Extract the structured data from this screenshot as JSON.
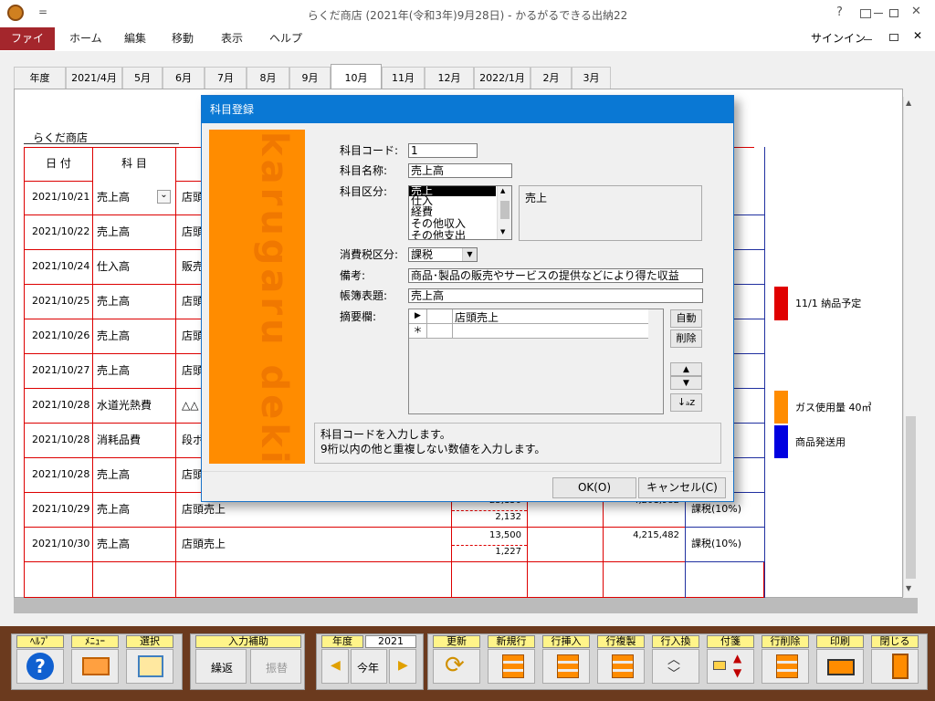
{
  "window": {
    "title": "らくだ商店 (2021年(令和3年)9月28日) - かるがるできる出納22",
    "help_glyph": "?",
    "quick_access_glyph": "="
  },
  "ribbon": {
    "tabs": [
      "ファイル",
      "ホーム",
      "編集",
      "移動",
      "表示",
      "ヘルプ"
    ],
    "signin": "サインイン"
  },
  "month_tabs": [
    "年度",
    "2021/4月",
    "5月",
    "6月",
    "7月",
    "8月",
    "9月",
    "10月",
    "11月",
    "12月",
    "2022/1月",
    "2月",
    "3月"
  ],
  "selected_month": "10月",
  "ledger": {
    "company": "らくだ商店",
    "headers": {
      "date": "日 付",
      "subject": "科 目"
    },
    "rows": [
      {
        "date": "2021/10/21",
        "subject": "売上高",
        "desc": "店頭"
      },
      {
        "date": "2021/10/22",
        "subject": "売上高",
        "desc": "店頭"
      },
      {
        "date": "2021/10/24",
        "subject": "仕入高",
        "desc": "販売"
      },
      {
        "date": "2021/10/25",
        "subject": "売上高",
        "desc": "店頭"
      },
      {
        "date": "2021/10/26",
        "subject": "売上高",
        "desc": "店頭"
      },
      {
        "date": "2021/10/27",
        "subject": "売上高",
        "desc": "店頭"
      },
      {
        "date": "2021/10/28",
        "subject": "水道光熱費",
        "desc": "△△"
      },
      {
        "date": "2021/10/28",
        "subject": "消耗品費",
        "desc": "段ボ"
      },
      {
        "date": "2021/10/28",
        "subject": "売上高",
        "desc": "店頭"
      },
      {
        "date": "2021/10/29",
        "subject": "売上高",
        "desc": "店頭売上",
        "amount": "25,150",
        "tax": "2,132",
        "balance": "4,201,982",
        "tax_class": "課税(10%)"
      },
      {
        "date": "2021/10/30",
        "subject": "売上高",
        "desc": "店頭売上",
        "amount": "13,500",
        "tax": "1,227",
        "balance": "4,215,482",
        "tax_class": "課税(10%)"
      }
    ]
  },
  "side_notes": [
    {
      "text": "11/1 納品予定",
      "color": "#e00000"
    },
    {
      "text": "ガス使用量 40㎥",
      "color": "#ff8c00"
    },
    {
      "text": "商品発送用",
      "color": "#0000e0"
    }
  ],
  "dialog": {
    "title": "科目登録",
    "logo_text": "karugaru dekiru",
    "code_label": "科目コード:",
    "code_value": "1",
    "name_label": "科目名称:",
    "name_value": "売上高",
    "category_label": "科目区分:",
    "category_options": [
      "売上",
      "仕入",
      "経費",
      "その他収入",
      "その他支出"
    ],
    "category_selected": "売上",
    "tax_label": "消費税区分:",
    "tax_value": "課税",
    "note_label": "備考:",
    "note_value": "商品･製品の販売やサービスの提供などにより得た収益",
    "book_label": "帳簿表題:",
    "book_value": "売上高",
    "summary_label": "摘要欄:",
    "summary_rows": [
      "店頭売上"
    ],
    "summary_new_glyph": "＊",
    "summary_row_marker": "▶",
    "auto_button": "自動",
    "delete_button": "削除",
    "up_glyph": "▲",
    "down_glyph": "▼",
    "sort_glyph": "↓ₐz",
    "help_text_1": "科目コードを入力します。",
    "help_text_2": "9桁以内の他と重複しない数値を入力します。",
    "ok_button": "OK(O)",
    "cancel_button": "キャンセル(C)"
  },
  "toolbar": {
    "help": "ﾍﾙﾌﾟ",
    "menu": "ﾒﾆｭｰ",
    "select": "選択",
    "input_assist": "入力補助",
    "repeat": "繰返",
    "transfer": "振替",
    "year_label": "年度",
    "year_value": "2021",
    "this_year": "今年",
    "update": "更新",
    "new_line": "新規行",
    "insert_line": "行挿入",
    "copy_line": "行複製",
    "swap_line": "行入換",
    "sticky": "付箋",
    "delete_line": "行削除",
    "print": "印刷",
    "close": "閉じる"
  },
  "colors": {
    "accent": "#a4262c",
    "dialog_title": "#0a78d4",
    "toolbar_bg": "#6b3a1e",
    "logo": "#ff8c00"
  }
}
